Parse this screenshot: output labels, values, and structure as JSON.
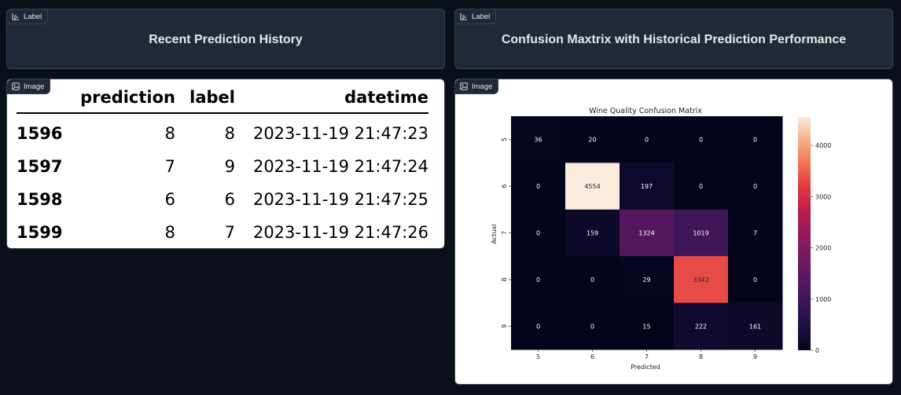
{
  "left": {
    "label_tag": "Label",
    "title": "Recent Prediction History",
    "image_tag": "Image",
    "table": {
      "columns": [
        "",
        "prediction",
        "label",
        "datetime"
      ],
      "rows": [
        {
          "index": "1596",
          "prediction": "8",
          "label": "8",
          "datetime": "2023-11-19 21:47:23"
        },
        {
          "index": "1597",
          "prediction": "7",
          "label": "9",
          "datetime": "2023-11-19 21:47:24"
        },
        {
          "index": "1598",
          "prediction": "6",
          "label": "6",
          "datetime": "2023-11-19 21:47:25"
        },
        {
          "index": "1599",
          "prediction": "8",
          "label": "7",
          "datetime": "2023-11-19 21:47:26"
        }
      ]
    }
  },
  "right": {
    "label_tag": "Label",
    "title": "Confusion Maxtrix with Historical Prediction Performance",
    "image_tag": "Image"
  },
  "icons": {
    "label": "label-icon",
    "image": "image-icon"
  },
  "colors": {
    "background": "#0b0f19",
    "panel": "#1f2937",
    "border": "#374151",
    "text": "#e5e7eb"
  },
  "chart_data": {
    "type": "heatmap",
    "title": "Wine Quality Confusion Matrix",
    "xlabel": "Predicted",
    "ylabel": "Actual",
    "x": [
      "5",
      "6",
      "7",
      "8",
      "9"
    ],
    "y": [
      "5",
      "6",
      "7",
      "8",
      "9"
    ],
    "values": [
      [
        36,
        20,
        0,
        0,
        0
      ],
      [
        0,
        4554,
        197,
        0,
        0
      ],
      [
        0,
        159,
        1324,
        1019,
        7
      ],
      [
        0,
        0,
        29,
        3342,
        0
      ],
      [
        0,
        0,
        15,
        222,
        161
      ]
    ],
    "colorbar": {
      "min": 0,
      "max": 4554,
      "ticks": [
        0,
        1000,
        2000,
        3000,
        4000
      ]
    },
    "colormap": "rocket"
  }
}
